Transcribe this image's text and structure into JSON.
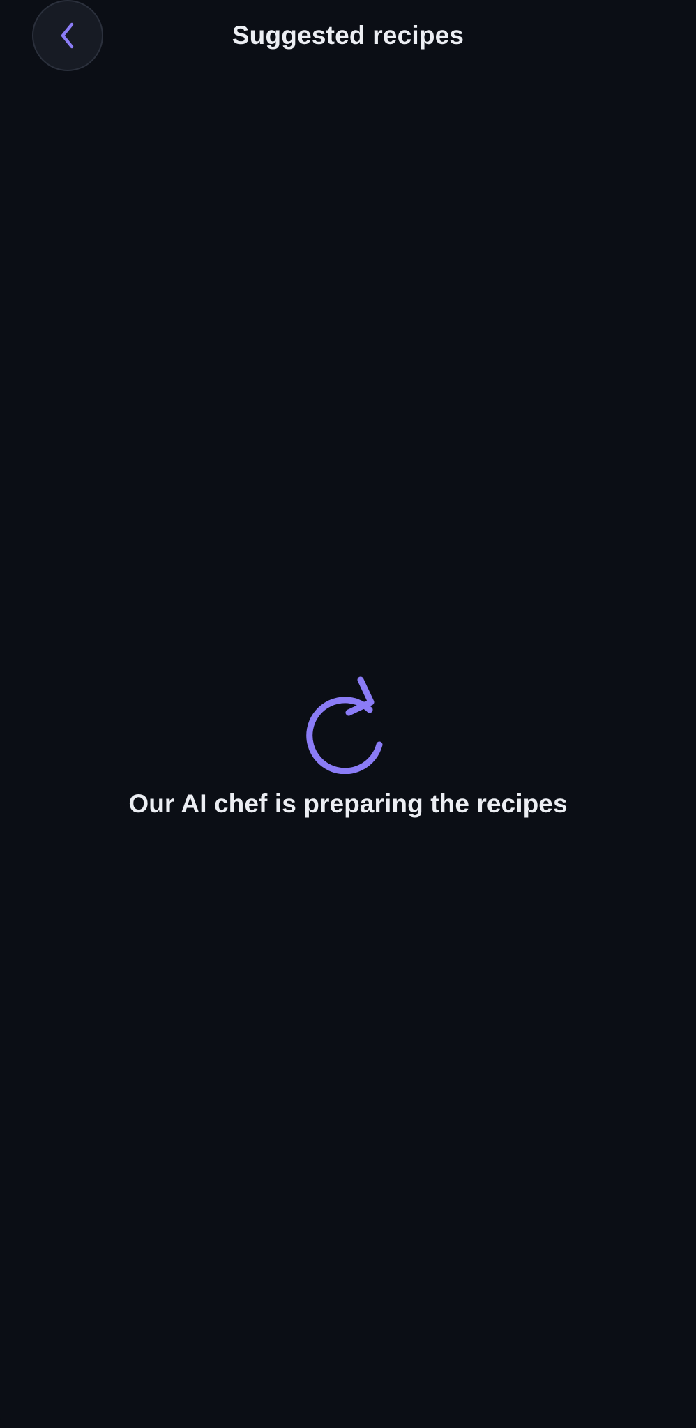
{
  "header": {
    "title": "Suggested recipes",
    "back_icon": "chevron-left-icon"
  },
  "loading": {
    "icon": "refresh-icon",
    "message": "Our AI chef is preparing the recipes"
  },
  "colors": {
    "background": "#0b0e15",
    "accent": "#8b7cf6",
    "text": "#eceef3",
    "back_button_bg": "#171b24"
  }
}
